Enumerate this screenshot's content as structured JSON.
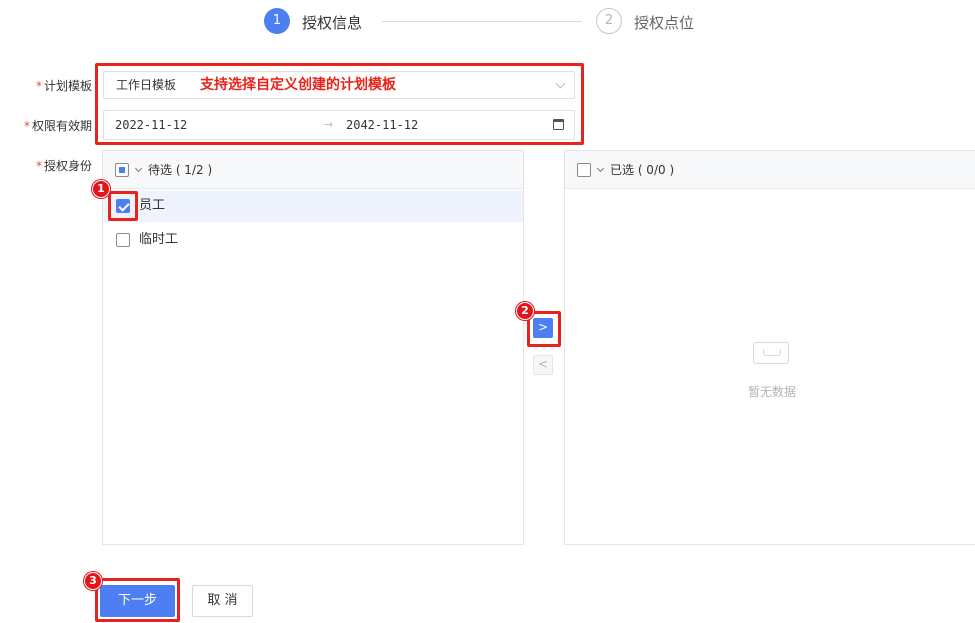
{
  "steps": [
    {
      "number": "1",
      "label": "授权信息",
      "state": "active"
    },
    {
      "number": "2",
      "label": "授权点位",
      "state": "inactive"
    }
  ],
  "form": {
    "plan_template": {
      "label": "计划模板",
      "value": "工作日模板",
      "hint": "支持选择自定义创建的计划模板"
    },
    "validity": {
      "label": "权限有效期",
      "start": "2022-11-12",
      "end": "2042-11-12",
      "separator": "→"
    },
    "identity": {
      "label": "授权身份"
    },
    "required_mark": "*"
  },
  "transfer": {
    "left": {
      "title": "待选 ( 1/2 )",
      "items": [
        {
          "label": "员工",
          "checked": true
        },
        {
          "label": "临时工",
          "checked": false
        }
      ]
    },
    "right": {
      "title": "已选 ( 0/0 )",
      "empty_text": "暂无数据"
    },
    "to_right": ">",
    "to_left": "<"
  },
  "annotations": [
    "1",
    "2",
    "3"
  ],
  "footer": {
    "next_label": "下一步",
    "cancel_label": "取 消"
  },
  "colors": {
    "primary": "#4d7ff3",
    "annotation_red": "#e8231b"
  }
}
